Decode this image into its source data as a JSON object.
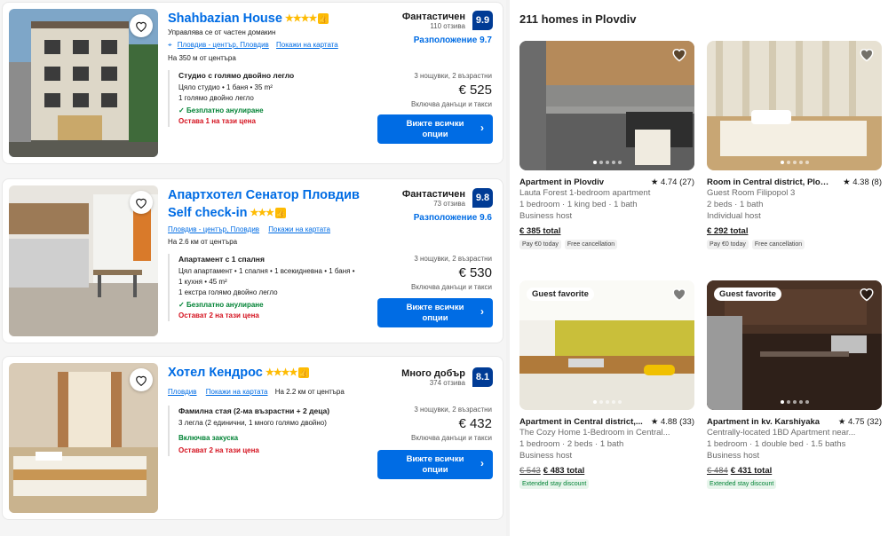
{
  "hotels": [
    {
      "name": "Shahbazian House",
      "stars": "★★★★",
      "subtitle": "Управлява се от частен домакин",
      "location": "Пловдив - център, Пловдив",
      "map": "Покажи на картата",
      "distance": "На 350 м от центъра",
      "score_word": "Фантастичен",
      "reviews": "110 отзива",
      "score": "9.9",
      "location_score": "Разположение 9.7",
      "room_title": "Студио с голямо двойно легло",
      "room_line1": "Цяло студио • 1 баня • 35 m²",
      "room_line2": "1 голямо двойно легло",
      "room_line3": "",
      "cancel": "Безплатно анулиране",
      "left": "Остава 1 на тази цена",
      "nights": "3 нощувки, 2 възрастни",
      "price": "€ 525",
      "taxes": "Включва данъци и такси",
      "button": "Вижте всички опции"
    },
    {
      "name": "Апартхотел Сенатор Пловдив Self check-in",
      "stars": "★★★",
      "subtitle": "",
      "location": "Пловдив - център, Пловдив",
      "map": "Покажи на картата",
      "distance": "На 2.6 км от центъра",
      "score_word": "Фантастичен",
      "reviews": "73 отзива",
      "score": "9.8",
      "location_score": "Разположение 9.6",
      "room_title": "Апартамент с 1 спалня",
      "room_line1": "Цял апартамент • 1 спалня • 1 всекидневна • 1 баня •",
      "room_line2": "1 кухня • 45 m²",
      "room_line3": "1 екстра голямо двойно легло",
      "cancel": "Безплатно анулиране",
      "left": "Остават 2 на тази цена",
      "nights": "3 нощувки, 2 възрастни",
      "price": "€ 530",
      "taxes": "Включва данъци и такси",
      "button": "Вижте всички опции"
    },
    {
      "name": "Хотел Кендрос",
      "stars": "★★★★",
      "subtitle": "",
      "location": "Пловдив",
      "map": "Покажи на картата",
      "distance": "На 2.2 км от центъра",
      "score_word": "Много добър",
      "reviews": "374 отзива",
      "score": "8.1",
      "location_score": "",
      "room_title": "Фамилна стая (2-ма възрастни + 2 деца)",
      "room_line1": "3 легла (2 единични, 1 много голямо двойно)",
      "room_line2": "",
      "room_line3": "",
      "breakfast": "Включва закуска",
      "left": "Остават 2 на тази цена",
      "nights": "3 нощувки, 2 възрастни",
      "price": "€ 432",
      "taxes": "Включва данъци и такси",
      "button": "Вижте всички опции"
    }
  ],
  "homes": {
    "title": "211 homes in Plovdiv",
    "listings": [
      {
        "type": "Apartment in Plovdiv",
        "rating": "★ 4.74 (27)",
        "name": "Lauta Forest 1-bedroom apartment",
        "beds": "1 bedroom · 1 king bed · 1 bath",
        "host": "Business host",
        "old_price": "",
        "total": "€ 385 total",
        "chip1": "Pay €0 today",
        "chip2": "Free cancellation",
        "badge": ""
      },
      {
        "type": "Room in Central district, Plovdiv",
        "rating": "★ 4.38 (8)",
        "name": "Guest Room Filipopol 3",
        "beds": "2 beds · 1 bath",
        "host": "Individual host",
        "old_price": "",
        "total": "€ 292 total",
        "chip1": "Pay €0 today",
        "chip2": "Free cancellation",
        "badge": ""
      },
      {
        "type": "Apartment in Central district,...",
        "rating": "★ 4.88 (33)",
        "name": "The Cozy Home 1-Bedroom in Central...",
        "beds": "1 bedroom · 2 beds · 1 bath",
        "host": "Business host",
        "old_price": "€ 543",
        "total": "€ 483 total",
        "chip1": "Extended stay discount",
        "chip2": "",
        "badge": "Guest favorite"
      },
      {
        "type": "Apartment in kv. Karshiyaka",
        "rating": "★ 4.75 (32)",
        "name": "Centrally-located 1BD Apartment near...",
        "beds": "1 bedroom · 1 double bed · 1.5 baths",
        "host": "Business host",
        "old_price": "€ 484",
        "total": "€ 431 total",
        "chip1": "Extended stay discount",
        "chip2": "",
        "badge": "Guest favorite"
      }
    ]
  }
}
